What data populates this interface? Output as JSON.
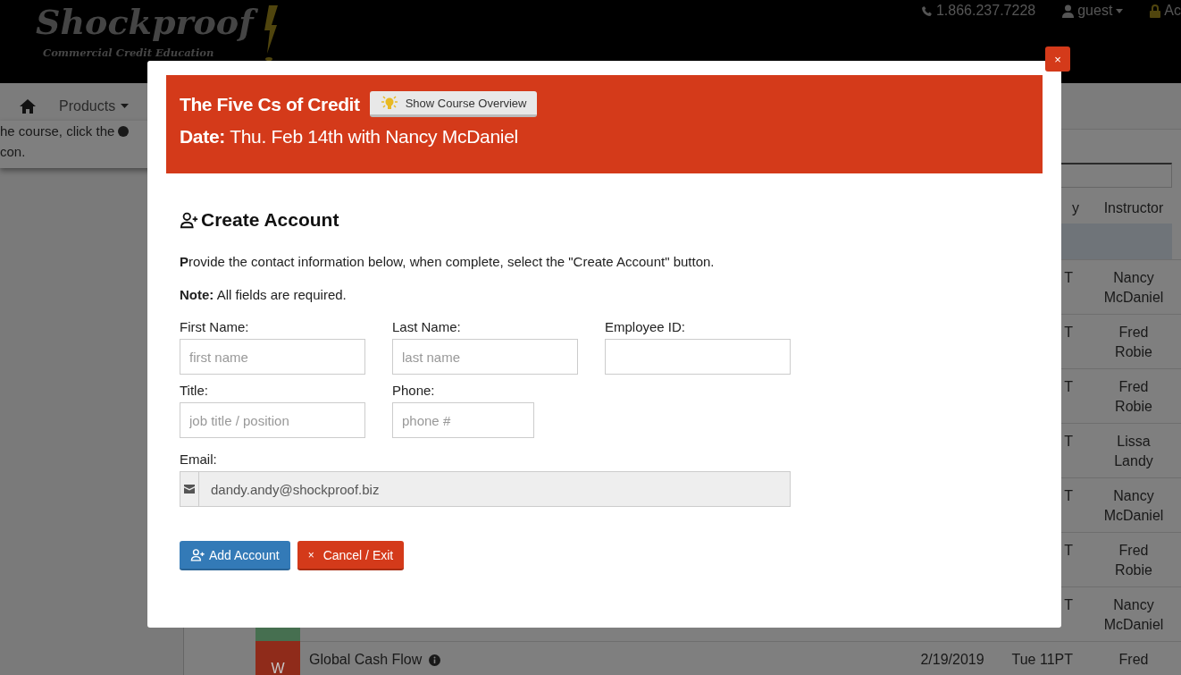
{
  "site_header": {
    "logo_title": "Shockproof",
    "logo_subtitle": "Commercial Credit Education",
    "phone": "1.866.237.7228",
    "user": "guest",
    "account": "Ac"
  },
  "nav": {
    "items": [
      {
        "label": "Products"
      }
    ]
  },
  "side_note": {
    "lines": [
      "he course, click the",
      "con."
    ]
  },
  "schedule": {
    "columns": [
      "y",
      "Instructor"
    ],
    "rows": [
      {
        "kind": "group"
      },
      {
        "kind": "course",
        "time": "T",
        "instructor": "Nancy McDaniel"
      },
      {
        "kind": "course",
        "time": "T",
        "instructor": "Fred Robie"
      },
      {
        "kind": "course",
        "time": "T",
        "instructor": "Fred Robie"
      },
      {
        "kind": "course",
        "time": "T",
        "instructor": "Lissa Landy"
      },
      {
        "kind": "course",
        "time": "T",
        "instructor": "Nancy McDaniel"
      },
      {
        "kind": "course",
        "time": "T",
        "instructor": "Fred Robie"
      },
      {
        "kind": "course",
        "color": "#466f50",
        "time": "T",
        "instructor": "Nancy McDaniel"
      },
      {
        "kind": "course",
        "color": "#8f2b1a",
        "badge": "W",
        "title": "Global Cash Flow",
        "date": "2/19/2019",
        "time": "Tue 11PT",
        "instructor": "Fred"
      }
    ]
  },
  "modal": {
    "close": "×",
    "title": "The Five Cs of Credit",
    "overview_button": "Show Course Overview",
    "date_line": "**Date:** Thu. Feb 14th with Nancy McDaniel",
    "section_title": "Create Account",
    "intro": "**P**rovide the contact information below, when complete, select the \"Create Account\" button.",
    "note": "**Note:** All fields are required.",
    "field_rows": [
      [
        {
          "kind": "text",
          "label": "First Name:",
          "placeholder": "first name"
        },
        {
          "kind": "text",
          "label": "Last Name:",
          "placeholder": "last name"
        },
        {
          "kind": "text",
          "label": "Employee ID:"
        }
      ],
      [
        {
          "kind": "text",
          "label": "Title:",
          "placeholder": "job title / position"
        },
        {
          "kind": "short",
          "label": "Phone:",
          "placeholder": "phone #"
        }
      ],
      [
        {
          "kind": "email",
          "label": "Email:",
          "value": "dandy.andy@shockproof.biz"
        }
      ]
    ],
    "buttons": [
      {
        "kind": "primary",
        "label": "Add Account"
      },
      {
        "kind": "danger",
        "glyph": "×",
        "label": "Cancel / Exit"
      }
    ]
  }
}
